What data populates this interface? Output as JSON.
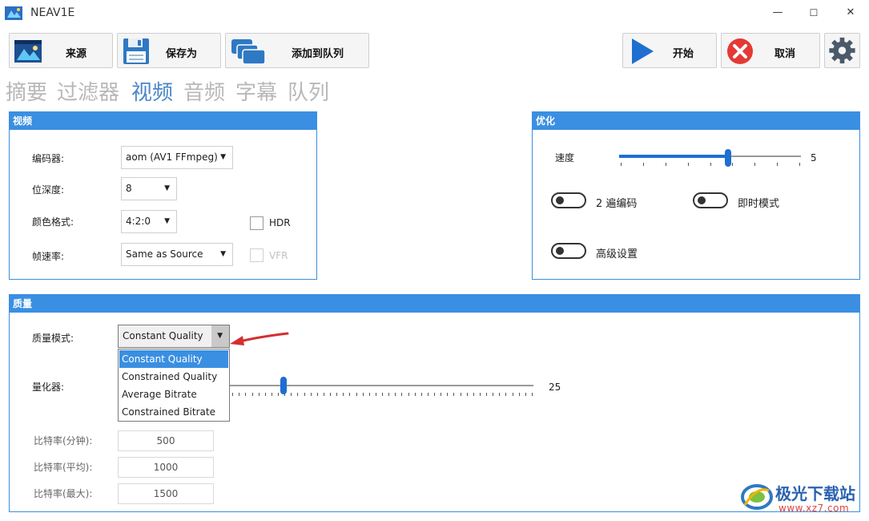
{
  "window": {
    "title": "NEAV1E",
    "minimize": "—",
    "maximize": "☐",
    "close": "✕"
  },
  "toolbar": {
    "source_label": "来源",
    "save_as_label": "保存为",
    "add_queue_label": "添加到队列",
    "start_label": "开始",
    "cancel_label": "取消"
  },
  "tabs": [
    {
      "label": "摘要",
      "active": false
    },
    {
      "label": "过滤器",
      "active": false
    },
    {
      "label": "视频",
      "active": true
    },
    {
      "label": "音频",
      "active": false
    },
    {
      "label": "字幕",
      "active": false
    },
    {
      "label": "队列",
      "active": false
    }
  ],
  "video_group": {
    "title": "视频",
    "encoder_label": "编码器:",
    "encoder_value": "aom (AV1 FFmpeg)",
    "bitdepth_label": "位深度:",
    "bitdepth_value": "8",
    "color_label": "颜色格式:",
    "color_value": "4:2:0",
    "hdr_label": "HDR",
    "fps_label": "帧速率:",
    "fps_value": "Same as Source",
    "vfr_label": "VFR"
  },
  "opt_group": {
    "title": "优化",
    "speed_label": "速度",
    "speed_value": "5",
    "speed_fraction": 0.6,
    "twopass_label": "2 遍编码",
    "realtime_label": "即时模式",
    "advanced_label": "高级设置"
  },
  "quality_group": {
    "title": "质量",
    "mode_label": "质量模式:",
    "mode_value": "Constant Quality",
    "mode_options": [
      "Constant Quality",
      "Constrained Quality",
      "Average Bitrate",
      "Constrained Bitrate"
    ],
    "quantizer_label": "量化器:",
    "quantizer_value": "25",
    "bitrate_min_label": "比特率(分钟):",
    "bitrate_min_value": "500",
    "bitrate_avg_label": "比特率(平均):",
    "bitrate_avg_value": "1000",
    "bitrate_max_label": "比特率(最大):",
    "bitrate_max_value": "1500"
  },
  "watermark": {
    "name": "极光下载站",
    "url": "www.xz7.com"
  },
  "colors": {
    "accent": "#3a8fe2",
    "active_tab": "#4a86c8",
    "cancel_red": "#e53935",
    "arrow_red": "#d32f2f"
  }
}
